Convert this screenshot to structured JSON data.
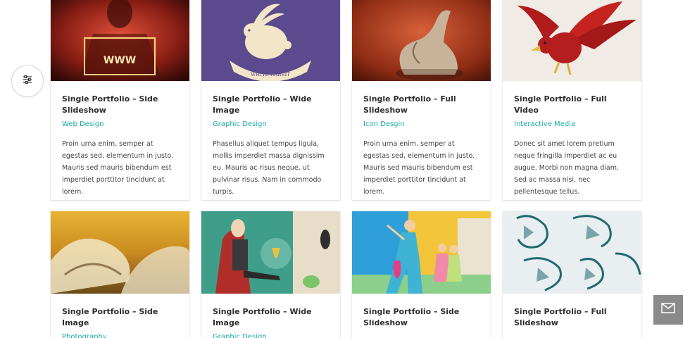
{
  "filter": {
    "icon": "sliders-icon"
  },
  "contact": {
    "icon": "envelope-icon"
  },
  "cards": [
    {
      "title": "Single Portfolio – Side Slideshow",
      "category": "Web Design",
      "description": "Proin urna enim, semper at egestas sed, elementum in justo. Mauris sed mauris bibendum est imperdiet porttitor tincidunt at lorem."
    },
    {
      "title": "Single Portfolio – Wide Image",
      "category": "Graphic Design",
      "description": "Phasellus aliquet tempus ligula, mollis imperdiet massa dignissim eu. Mauris ac risus neque, ut pulvinar risus. Nam in commodo turpis."
    },
    {
      "title": "Single Portfolio – Full Slideshow",
      "category": "Icon Desgin",
      "description": "Proin urna enim, semper at egestas sed, elementum in justo. Mauris sed mauris bibendum est imperdiet porttitor tincidunt at lorem."
    },
    {
      "title": "Single Portfolio – Full Video",
      "category": "Interactive Media",
      "description": "Donec sit amet lorem pretium neque fringilla imperdiet ac eu augue. Morbi non magna diam. Sed ac massa nisi, nec pellentesque tellus."
    },
    {
      "title": "Single Portfolio – Side Image",
      "category": "Photography"
    },
    {
      "title": "Single Portfolio – Wide Image",
      "category": "Graphic Design"
    },
    {
      "title": "Single Portfolio – Side Slideshow",
      "category": ""
    },
    {
      "title": "Single Portfolio – Full Slideshow",
      "category": ""
    }
  ],
  "thumbnails": {
    "www_text": "WWW",
    "rabbit_text": "WHITE RABBIT"
  }
}
